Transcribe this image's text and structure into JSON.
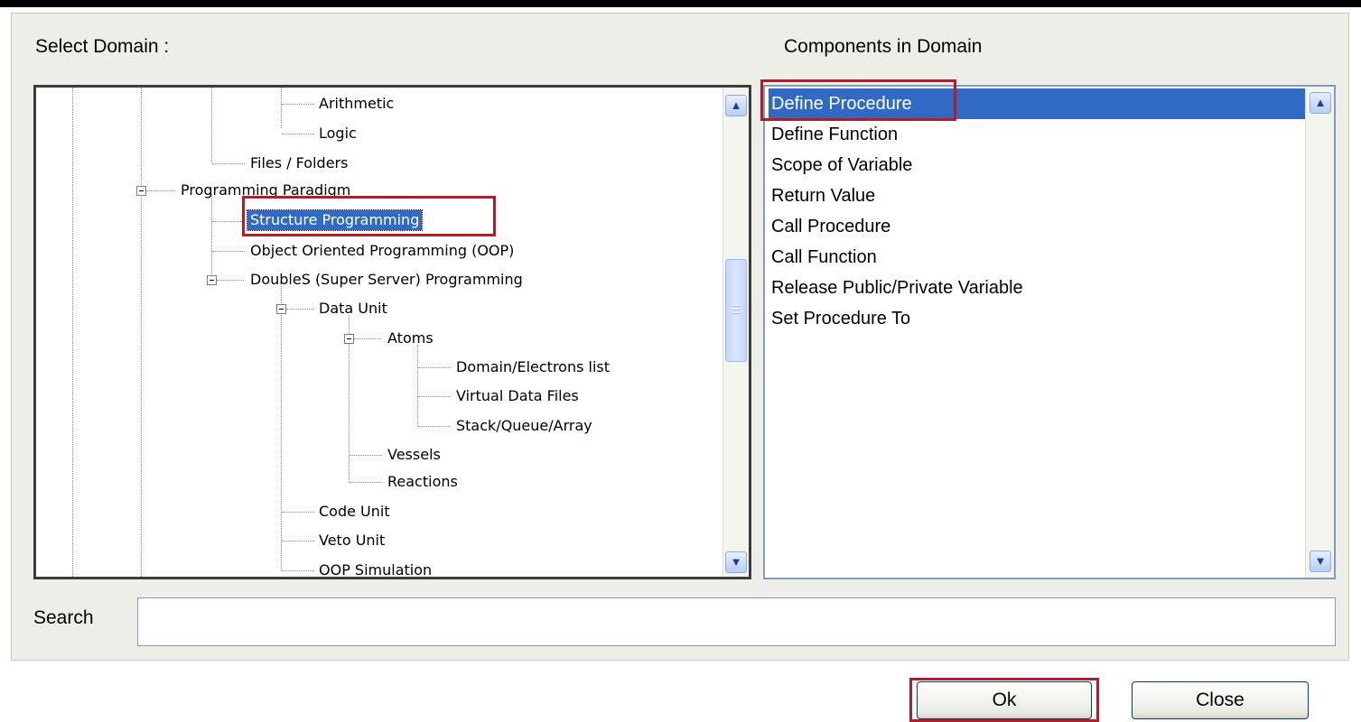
{
  "dialog": {
    "select_domain_label": "Select Domain :",
    "components_label": "Components in Domain",
    "search_label": "Search",
    "search_value": "",
    "ok_label": "Ok",
    "close_label": "Close"
  },
  "tree": {
    "nodes": [
      {
        "label": "Arithmetic"
      },
      {
        "label": "Logic"
      },
      {
        "label": "Files / Folders"
      },
      {
        "label": "Programming Paradigm"
      },
      {
        "label": "Structure Programming",
        "selected": true
      },
      {
        "label": "Object Oriented Programming (OOP)"
      },
      {
        "label": "DoubleS (Super Server) Programming"
      },
      {
        "label": "Data Unit"
      },
      {
        "label": "Atoms"
      },
      {
        "label": "Domain/Electrons list"
      },
      {
        "label": "Virtual Data Files"
      },
      {
        "label": "Stack/Queue/Array"
      },
      {
        "label": "Vessels"
      },
      {
        "label": "Reactions"
      },
      {
        "label": "Code Unit"
      },
      {
        "label": "Veto Unit"
      },
      {
        "label": "OOP Simulation"
      }
    ]
  },
  "components": {
    "items": [
      "Define Procedure",
      "Define Function",
      "Scope of Variable",
      "Return Value",
      "Call Procedure",
      "Call Function",
      "Release Public/Private Variable",
      "Set Procedure To"
    ],
    "selected_index": 0
  },
  "colors": {
    "selection": "#316ac5",
    "highlight_box": "#b01e2a",
    "dialog_background": "#eeeee9"
  }
}
